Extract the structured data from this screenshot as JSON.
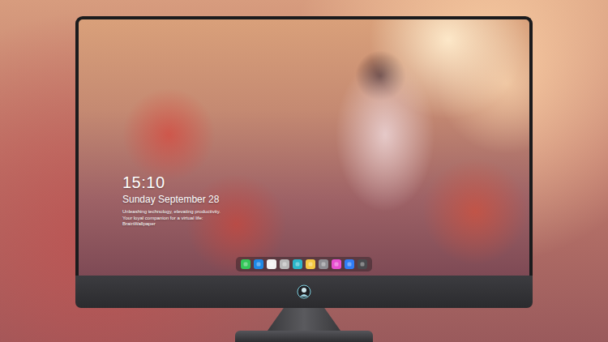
{
  "clock": {
    "time": "15:10",
    "date": "Sunday September 28",
    "tagline": "Unleashing technology, elevating productivity. Your loyal companion for a virtual life: BrainWallpaper"
  },
  "dock": {
    "items": [
      {
        "color": "#34c759"
      },
      {
        "color": "#1e88e5"
      },
      {
        "color": "#f2f2f2"
      },
      {
        "color": "#b8b8b8"
      },
      {
        "color": "#2bb5c9"
      },
      {
        "color": "#f5c842"
      },
      {
        "color": "#8e8e93"
      },
      {
        "color": "#e84fd1"
      },
      {
        "color": "#2f7cf6"
      },
      {
        "color": "#4a4a4e"
      }
    ]
  }
}
